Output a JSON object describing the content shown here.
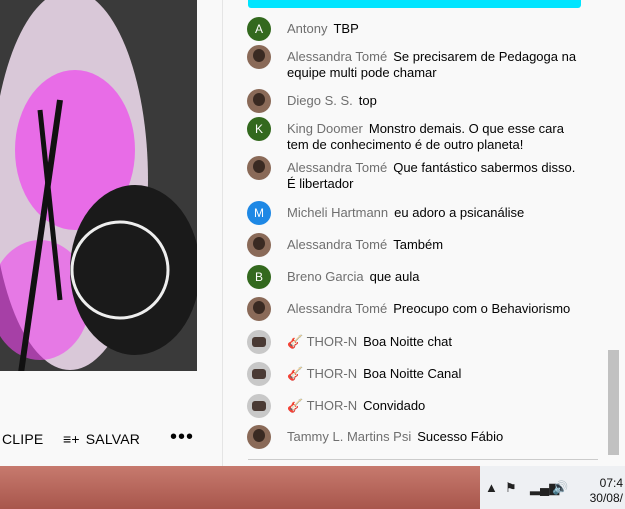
{
  "actions": {
    "clip_label": "CLIPE",
    "save_label": "SALVAR",
    "more_label": "•••"
  },
  "chat": {
    "messages": [
      {
        "author": "Antony",
        "text": "TBP",
        "avatar_letter": "A",
        "avatar_color": "#33691e"
      },
      {
        "author": "Alessandra Tomé",
        "text": "Se precisarem de Pedagoga na equipe multi pode chamar",
        "avatar_letter": "",
        "avatar_color": ""
      },
      {
        "author": "Diego S. S.",
        "text": "top",
        "avatar_letter": "",
        "avatar_color": ""
      },
      {
        "author": "King Doomer",
        "text": "Monstro demais. O que esse cara tem de conhecimento é de outro planeta!",
        "avatar_letter": "K",
        "avatar_color": "#33691e"
      },
      {
        "author": "Alessandra Tomé",
        "text": "Que fantástico sabermos disso. É libertador",
        "avatar_letter": "",
        "avatar_color": ""
      },
      {
        "author": "Micheli Hartmann",
        "text": "eu adoro a psicanálise",
        "avatar_letter": "M",
        "avatar_color": "#1e88e5"
      },
      {
        "author": "Alessandra Tomé",
        "text": "Também",
        "avatar_letter": "",
        "avatar_color": ""
      },
      {
        "author": "Breno Garcia",
        "text": "que aula",
        "avatar_letter": "B",
        "avatar_color": "#33691e"
      },
      {
        "author": "Alessandra Tomé",
        "text": "Preocupo com o Behaviorismo",
        "avatar_letter": "",
        "avatar_color": ""
      },
      {
        "author": "🎸 THOR-N",
        "text": "Boa Noitte chat",
        "avatar_letter": "",
        "avatar_color": ""
      },
      {
        "author": "🎸 THOR-N",
        "text": "Boa Noitte Canal",
        "avatar_letter": "",
        "avatar_color": ""
      },
      {
        "author": "🎸 THOR-N",
        "text": "Convidado",
        "avatar_letter": "",
        "avatar_color": ""
      },
      {
        "author": "Tammy L. Martins Psi",
        "text": "Sucesso Fábio",
        "avatar_letter": "",
        "avatar_color": ""
      }
    ]
  },
  "taskbar": {
    "time": "07:4",
    "date": "30/08/"
  },
  "colors": {
    "accent": "#00e5ff",
    "taskbar": "#b5625a"
  }
}
